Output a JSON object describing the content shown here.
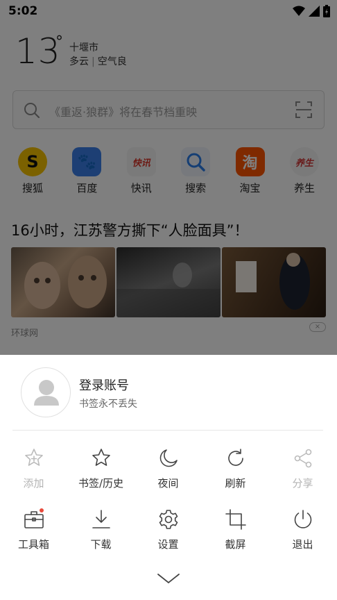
{
  "status_bar": {
    "time": "5:02"
  },
  "weather": {
    "temperature": "13",
    "degree_symbol": "°",
    "city": "十堰市",
    "condition": "多云",
    "air_quality": "空气良"
  },
  "search": {
    "placeholder": "《重返·狼群》将在春节档重映"
  },
  "quick_links": [
    {
      "label": "搜狐",
      "icon": "sohu-icon",
      "color": "#f6c200",
      "glyph": "S"
    },
    {
      "label": "百度",
      "icon": "baidu-icon",
      "color": "#3a7ee8",
      "glyph": "🐾"
    },
    {
      "label": "快讯",
      "icon": "kuaixun-icon",
      "color": "#d9362b",
      "glyph": "快讯"
    },
    {
      "label": "搜索",
      "icon": "search-icon",
      "color": "#2b7de9",
      "glyph": ""
    },
    {
      "label": "淘宝",
      "icon": "taobao-icon",
      "color": "#ff5500",
      "glyph": "淘"
    },
    {
      "label": "养生",
      "icon": "yangsheng-icon",
      "color": "#d23a3a",
      "glyph": "养生"
    }
  ],
  "news": {
    "title": "16小时，江苏警方撕下“人脸面具”！",
    "source": "环球网",
    "close_glyph": "×"
  },
  "account": {
    "title": "登录账号",
    "subtitle": "书签永不丢失"
  },
  "menu_rows": [
    [
      {
        "label": "添加",
        "icon": "add-bookmark-star-icon",
        "enabled": false
      },
      {
        "label": "书签/历史",
        "icon": "star-icon",
        "enabled": true
      },
      {
        "label": "夜间",
        "icon": "moon-icon",
        "enabled": true
      },
      {
        "label": "刷新",
        "icon": "refresh-icon",
        "enabled": true
      },
      {
        "label": "分享",
        "icon": "share-icon",
        "enabled": false
      }
    ],
    [
      {
        "label": "工具箱",
        "icon": "toolbox-icon",
        "enabled": true,
        "badge": true
      },
      {
        "label": "下载",
        "icon": "download-icon",
        "enabled": true
      },
      {
        "label": "设置",
        "icon": "gear-icon",
        "enabled": true
      },
      {
        "label": "截屏",
        "icon": "crop-screenshot-icon",
        "enabled": true
      },
      {
        "label": "退出",
        "icon": "power-icon",
        "enabled": true
      }
    ]
  ],
  "colors": {
    "overlay": "#000000",
    "badge": "#e84a3c",
    "icon_stroke": "#444444",
    "icon_disabled": "#bbbbbb"
  }
}
